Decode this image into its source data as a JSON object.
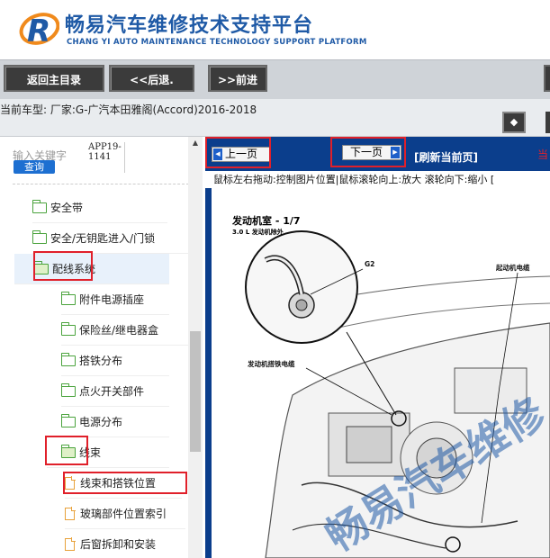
{
  "header": {
    "title_cn": "畅易汽车维修技术支持平台",
    "title_en": "CHANG YI AUTO MAINTENANCE TECHNOLOGY SUPPORT PLATFORM",
    "logo_icon": "logo-r-icon",
    "brand_color": "#1f5aa6"
  },
  "nav": {
    "home": "返回主目录",
    "back": "<<后退.",
    "forward": ">>前进"
  },
  "vehicle": {
    "text": "当前车型:   厂家:G-广汽本田雅阁(Accord)2016-2018",
    "expand_icon": "expand-icon"
  },
  "sidebar": {
    "search_label": "输入关键字",
    "search_value": "APP19-1141",
    "query_btn": "查询",
    "items": [
      {
        "label": "安全带",
        "icon": "folder-icon"
      },
      {
        "label": "安全/无钥匙进入/门锁",
        "icon": "folder-icon"
      },
      {
        "label": "配线系统",
        "icon": "folder-open-icon"
      },
      {
        "label": "附件电源插座",
        "icon": "folder-icon"
      },
      {
        "label": "保险丝/继电器盒",
        "icon": "folder-icon"
      },
      {
        "label": "搭铁分布",
        "icon": "folder-icon"
      },
      {
        "label": "点火开关部件",
        "icon": "folder-icon"
      },
      {
        "label": "电源分布",
        "icon": "folder-icon"
      },
      {
        "label": "线束",
        "icon": "folder-open-icon"
      },
      {
        "label": "线束和搭铁位置",
        "icon": "document-icon"
      },
      {
        "label": "玻璃部件位置索引",
        "icon": "document-icon"
      },
      {
        "label": "后窗拆卸和安装",
        "icon": "document-icon"
      }
    ]
  },
  "viewer": {
    "prev": "上一页",
    "next": "下一页",
    "refresh": "[刷新当前页]",
    "extra": "当",
    "hint": "鼠标左右拖动:控制图片位置|鼠标滚轮向上:放大  滚轮向下:缩小  [",
    "doc_title": "发动机室 - 1/7",
    "doc_subtitle": "3.0 L 发动机除外",
    "callouts": {
      "g2": "G2",
      "starter": "起动机电缆",
      "ground_cable": "发动机搭铁电缆"
    },
    "watermark": "畅易汽车维修",
    "accent_color": "#0b3e8c",
    "highlight_color": "#e0202a"
  }
}
